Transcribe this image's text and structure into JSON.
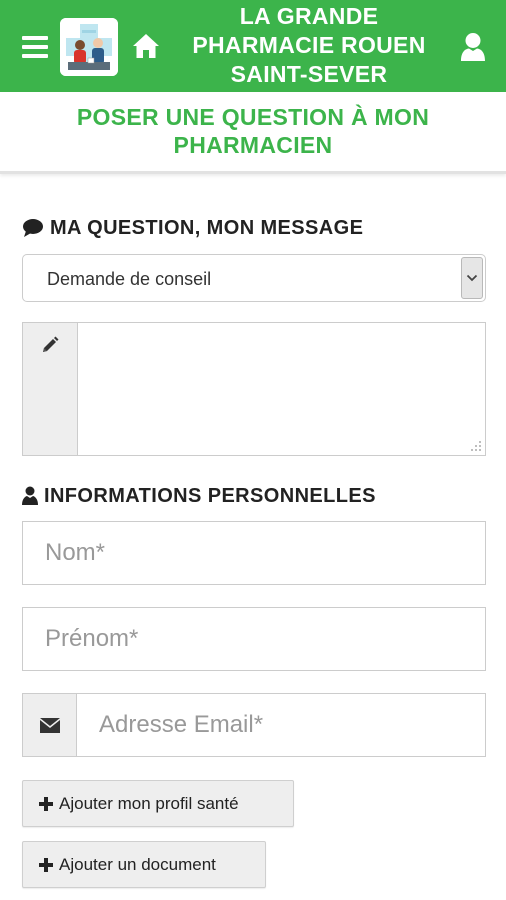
{
  "app": {
    "title": "LA GRANDE\nPHARMACIE ROUEN\nSAINT-SEVER",
    "brand_color": "#3cb44b"
  },
  "page": {
    "title": "POSER UNE QUESTION À MON\nPHARMACIEN"
  },
  "icons": {
    "menu": "hamburger-icon",
    "home": "home-icon",
    "user": "user-icon",
    "comment": "comment-icon",
    "pencil": "pencil-icon",
    "person": "person-icon",
    "envelope": "envelope-icon",
    "plus": "plus-icon"
  },
  "question_section": {
    "title": "MA QUESTION, MON MESSAGE",
    "type_select": {
      "selected": "Demande de conseil"
    },
    "message": {
      "value": ""
    }
  },
  "personal_section": {
    "title": "INFORMATIONS PERSONNELLES",
    "last_name": {
      "placeholder": "Nom*",
      "value": ""
    },
    "first_name": {
      "placeholder": "Prénom*",
      "value": ""
    },
    "email": {
      "placeholder": "Adresse Email*",
      "value": ""
    }
  },
  "buttons": {
    "add_health_profile": "Ajouter mon profil santé",
    "add_document": "Ajouter un document"
  }
}
